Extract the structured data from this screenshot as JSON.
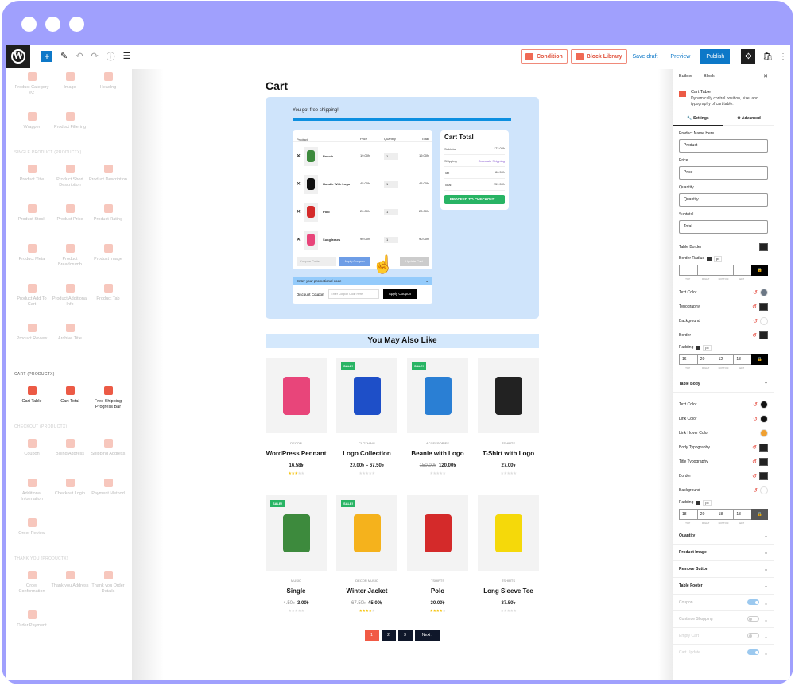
{
  "window": {
    "traffic_lights": 3
  },
  "toolbar": {
    "wp_logo": "W",
    "add_label": "+",
    "condition_label": "Condition",
    "block_library_label": "Block Library",
    "save_draft_label": "Save draft",
    "preview_label": "Preview",
    "publish_label": "Publish"
  },
  "left_sidebar": {
    "top_blocks": [
      {
        "label": "Product Category #2",
        "icon": "grid-icon"
      },
      {
        "label": "Image",
        "icon": "image-icon"
      },
      {
        "label": "Heading",
        "icon": "heading-icon"
      },
      {
        "label": "Wrapper",
        "icon": "wrapper-icon"
      },
      {
        "label": "Product Filtering",
        "icon": "filter-icon"
      }
    ],
    "sections": [
      {
        "title": "SINGLE PRODUCT (PRODUCTX)",
        "active": false,
        "blocks": [
          {
            "label": "Product Title",
            "icon": "title-icon"
          },
          {
            "label": "Product Short Description",
            "icon": "short-description-icon"
          },
          {
            "label": "Product Description",
            "icon": "description-icon"
          },
          {
            "label": "Product Stock",
            "icon": "stock-icon"
          },
          {
            "label": "Product Price",
            "icon": "price-tag-icon"
          },
          {
            "label": "Product Rating",
            "icon": "star-icon"
          },
          {
            "label": "Product Meta",
            "icon": "meta-icon"
          },
          {
            "label": "Product Breadcrumb",
            "icon": "breadcrumb-icon"
          },
          {
            "label": "Product Image",
            "icon": "product-image-icon"
          },
          {
            "label": "Product Add To Cart",
            "icon": "cart-icon"
          },
          {
            "label": "Product Additional Info",
            "icon": "info-icon"
          },
          {
            "label": "Product Tab",
            "icon": "tab-icon"
          },
          {
            "label": "Product Review",
            "icon": "review-icon"
          },
          {
            "label": "Archive Title",
            "icon": "archive-title-icon"
          }
        ]
      },
      {
        "title": "CART (PRODUCTX)",
        "active": true,
        "blocks": [
          {
            "label": "Cart Table",
            "icon": "cart-table-icon"
          },
          {
            "label": "Cart Total",
            "icon": "cart-total-icon"
          },
          {
            "label": "Free Shipping Progress Bar",
            "icon": "shipping-truck-icon"
          }
        ]
      },
      {
        "title": "CHECKOUT (PRODUCTX)",
        "active": false,
        "blocks": [
          {
            "label": "Coupon",
            "icon": "coupon-icon"
          },
          {
            "label": "Billing Address",
            "icon": "billing-icon"
          },
          {
            "label": "Shipping Address",
            "icon": "location-icon"
          },
          {
            "label": "Additional Information",
            "icon": "additional-info-icon"
          },
          {
            "label": "Checkout Login",
            "icon": "login-icon"
          },
          {
            "label": "Payment Method",
            "icon": "payment-icon"
          },
          {
            "label": "Order Review",
            "icon": "order-review-icon"
          }
        ]
      },
      {
        "title": "THANK YOU (PRODUCTX)",
        "active": false,
        "blocks": [
          {
            "label": "Order Conformation",
            "icon": "order-cart-icon"
          },
          {
            "label": "Thank you Address",
            "icon": "pin-icon"
          },
          {
            "label": "Thank you Order Details",
            "icon": "order-details-icon"
          },
          {
            "label": "Order Payment",
            "icon": "order-payment-icon"
          }
        ]
      }
    ]
  },
  "canvas": {
    "page_title": "Cart",
    "free_shipping_text": "You got free shipping!",
    "free_shipping_progress": 1.0,
    "cart_table": {
      "headers": [
        "Product",
        "Price",
        "Quantity",
        "Total"
      ],
      "rows": [
        {
          "name": "Beanie",
          "price": "19.00৳",
          "qty": "1",
          "total": "19.00৳",
          "color": "#3d8a3d"
        },
        {
          "name": "Hoodie With Logo",
          "price": "45.00৳",
          "qty": "1",
          "total": "45.00৳",
          "color": "#111111"
        },
        {
          "name": "Polo",
          "price": "20.00৳",
          "qty": "1",
          "total": "20.00৳",
          "color": "#d42a2a"
        },
        {
          "name": "Sunglasses",
          "price": "90.00৳",
          "qty": "1",
          "total": "90.00৳",
          "color": "#e8457a"
        }
      ],
      "coupon_placeholder": "Coupon Code",
      "apply_coupon_label": "Apply Coupon",
      "update_cart_label": "Update Cart"
    },
    "promo": {
      "header": "Enter your promotional code",
      "label": "Discount Coupon",
      "placeholder": "Enter Coupon Code Here",
      "button": "Apply Coupon"
    },
    "cart_total": {
      "title": "Cart Total",
      "rows": [
        {
          "label": "Subtotal",
          "value": "173.00৳"
        },
        {
          "label": "Shipping",
          "value": "Calculate Shipping"
        },
        {
          "label": "Tax",
          "value": "86.50৳"
        },
        {
          "label": "Total",
          "value": "259.50৳"
        }
      ],
      "checkout_label": "PROCEED TO CHECKOUT →"
    },
    "related_title": "You May Also Like",
    "products": [
      {
        "category": "DECOR",
        "name": "WordPress Pennant",
        "old_price": "",
        "price": "16.58৳",
        "rating": 3,
        "sale": false,
        "color": "#e8457a"
      },
      {
        "category": "CLOTHING",
        "name": "Logo Collection",
        "old_price": "",
        "price": "27.00৳ – 67.50৳",
        "rating": 0,
        "sale": true,
        "color": "#1e4fc8"
      },
      {
        "category": "ACCESSORIES",
        "name": "Beanie with Logo",
        "old_price": "150.00৳",
        "price": "120.00৳",
        "rating": 0,
        "sale": true,
        "color": "#2a7fd4"
      },
      {
        "category": "TSHIRTS",
        "name": "T-Shirt with Logo",
        "old_price": "",
        "price": "27.00৳",
        "rating": 0,
        "sale": false,
        "color": "#222222"
      },
      {
        "category": "MUSIC",
        "name": "Single",
        "old_price": "4.50৳",
        "price": "3.00৳",
        "rating": 0,
        "sale": true,
        "color": "#3d8a3d"
      },
      {
        "category": "DECOR MUSIC",
        "name": "Winter Jacket",
        "old_price": "67.50৳",
        "price": "45.00৳",
        "rating": 3.5,
        "sale": true,
        "color": "#f5b21c"
      },
      {
        "category": "TSHIRTS",
        "name": "Polo",
        "old_price": "",
        "price": "30.00৳",
        "rating": 4,
        "sale": false,
        "color": "#d42a2a"
      },
      {
        "category": "TSHIRTS",
        "name": "Long Sleeve Tee",
        "old_price": "",
        "price": "37.50৳",
        "rating": 0,
        "sale": false,
        "color": "#f5d90a"
      }
    ],
    "sale_badge": "SALE!",
    "pagination": [
      "1",
      "2",
      "3",
      "Next ›"
    ],
    "current_page": "1"
  },
  "right_panel": {
    "tabs": [
      "Builder",
      "Block"
    ],
    "active_tab": "Block",
    "block_name": "Cart Table",
    "block_desc": "Dynamically control position, size, and typography of cart table.",
    "settings_tabs": [
      "Settings",
      "Advanced"
    ],
    "fields": [
      {
        "label": "Product Name Here",
        "value": "Product"
      },
      {
        "label": "Price",
        "value": "Price"
      },
      {
        "label": "Quantity",
        "value": "Quantity"
      },
      {
        "label": "Subtotal",
        "value": "Total"
      }
    ],
    "table_border_label": "Table Border",
    "border_radius_label": "Border Radius",
    "unit": "px",
    "dim_labels": [
      "TOP",
      "RIGHT",
      "BOTTOM",
      "LEFT"
    ],
    "border_radius_values": [
      "",
      "",
      "",
      ""
    ],
    "head_settings": [
      {
        "label": "Text Color",
        "type": "color",
        "color": "#6b7785"
      },
      {
        "label": "Typography",
        "type": "typo"
      },
      {
        "label": "Background",
        "type": "color",
        "color": "#ffffff"
      },
      {
        "label": "Border",
        "type": "typo"
      }
    ],
    "padding_label": "Padding",
    "head_padding": [
      "16",
      "20",
      "12",
      "13"
    ],
    "table_body_label": "Table Body",
    "body_settings": [
      {
        "label": "Text Color",
        "type": "color",
        "color": "#111111"
      },
      {
        "label": "Link Color",
        "type": "color",
        "color": "#111111"
      },
      {
        "label": "Link Hover Color",
        "type": "color",
        "color": "#f0a030"
      },
      {
        "label": "Body Typography",
        "type": "typo"
      },
      {
        "label": "Title Typography",
        "type": "typo"
      },
      {
        "label": "Border",
        "type": "typo"
      },
      {
        "label": "Background",
        "type": "color",
        "color": "#ffffff"
      }
    ],
    "body_padding": [
      "18",
      "20",
      "18",
      "13"
    ],
    "sections": [
      {
        "label": "Quantity",
        "toggle": null
      },
      {
        "label": "Product Image",
        "toggle": null
      },
      {
        "label": "Remove Button",
        "toggle": null
      },
      {
        "label": "Table Footer",
        "toggle": null
      },
      {
        "label": "Coupon",
        "toggle": true
      },
      {
        "label": "Continue Shopping",
        "toggle": false
      },
      {
        "label": "Empty Cart",
        "toggle": false
      },
      {
        "label": "Cart Update",
        "toggle": true
      }
    ]
  }
}
